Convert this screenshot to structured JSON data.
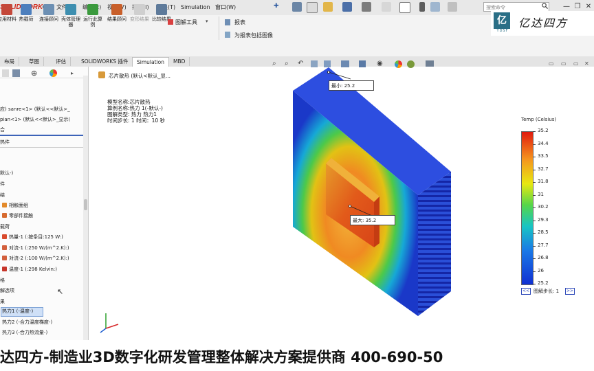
{
  "app": {
    "logo_text": "SOLIDWORKS"
  },
  "menu": [
    "文件(F)",
    "编辑(E)",
    "视图(V)",
    "插入(I)",
    "工具(T)",
    "Simulation",
    "窗口(W)"
  ],
  "search": {
    "placeholder": "搜索命令"
  },
  "window": {
    "minimize": "—",
    "restore": "❐",
    "close": "✕"
  },
  "ribbon": {
    "buttons": [
      "应用材料",
      "热载荷",
      "连接顾问",
      "壳体管理器",
      "运行此算例",
      "结果顾问",
      "变形结果",
      "比较结果"
    ],
    "right_items": [
      "图解工具",
      "报表",
      "为报表包括图像"
    ]
  },
  "brand": {
    "mark": "亿",
    "name": "亿达四方",
    "sub": "YDSF"
  },
  "tabs": [
    "布局",
    "草图",
    "评估",
    "SOLIDWORKS 插件",
    "Simulation",
    "MBD"
  ],
  "tree": {
    "items": [
      "应) sanre<1> (默认<<默认>_",
      "pian<1> (默认<<默认>_显示(",
      "合",
      "热件",
      "默认-)",
      "件",
      "结",
      "相触面组",
      "零部件接触",
      "载荷",
      "热量-1 (:按条目:125 W:)",
      "对流-1 (:250 W/(m^2.K):)",
      "对流-2 (:100 W/(m^2.K):)",
      "温度-1 (:298 Kelvin:)",
      "格",
      "解选项",
      "果",
      "热力1 (-温度-)",
      "热力2 (-合力温度梯度-)",
      "热力3 (-合力热流量-)"
    ]
  },
  "viewport": {
    "title": "芯片散热 (默认<默认_显...",
    "info_lines": [
      "模型名称:芯片散热",
      "算例名称:热力 1(-默认-)",
      "图解类型: 热力 热力1",
      "时间步长: 1  时间：10 秒"
    ],
    "min_label": "最小:",
    "min_value": "25.2",
    "max_label": "最大:",
    "max_value": "35.2"
  },
  "legend": {
    "title": "Temp (Celsius)",
    "ticks": [
      "35.2",
      "34.4",
      "33.5",
      "32.7",
      "31.8",
      "31",
      "30.2",
      "29.3",
      "28.5",
      "27.7",
      "26.8",
      "26",
      "25.2"
    ],
    "step_label": "图解步长: 1",
    "prev": "<<",
    "next": ">>"
  },
  "banner": {
    "text": "达四方-制造业3D数字化研发管理整体解决方案提供商  400-690-50"
  },
  "colors": {
    "accent": "#d12b1f",
    "brand": "#2a6f86",
    "hot": "#e01a0e",
    "cold": "#1030d2"
  }
}
